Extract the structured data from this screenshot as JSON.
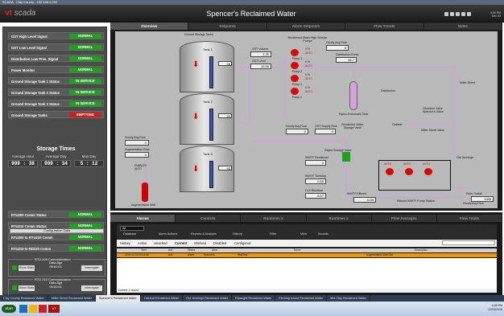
{
  "window": {
    "title": "SCADA - Clay County - 192.168.3.200"
  },
  "header": {
    "logo_prefix": "vt",
    "logo": "scada",
    "title": "Spencer's Reclaimed Water",
    "time": "4:00 PM",
    "date": "Dec 03"
  },
  "signals": [
    {
      "label": "GST High Level Signal",
      "status": "NORMAL",
      "color": "green"
    },
    {
      "label": "GST Low Level Signal",
      "status": "NORMAL",
      "color": "green"
    },
    {
      "label": "Distribution Low Pres. Signal",
      "status": "NORMAL",
      "color": "green"
    },
    {
      "label": "Power Monitor",
      "status": "NORMAL",
      "color": "green"
    },
    {
      "label": "Ground Storage Tank 1 Status",
      "status": "IN SERVICE",
      "color": "green"
    },
    {
      "label": "Ground Storage Tank 2 Status",
      "status": "IN SERVICE",
      "color": "green"
    },
    {
      "label": "Ground Storage Tank 3 Status",
      "status": "IN SERVICE",
      "color": "green"
    },
    {
      "label": "Ground Storage Tanks",
      "status": "EMPTYING",
      "color": "red"
    }
  ],
  "storage": {
    "title": "Storage Times",
    "cols": [
      {
        "h": "Average Hour",
        "v": "999 : 38"
      },
      {
        "h": "Average Day",
        "v": "999 : 34"
      },
      {
        "h": "Max Day",
        "v": "5 : 12"
      }
    ]
  },
  "config": {
    "label": "Configuration Data"
  },
  "rtu": {
    "title1": "RTU 200 Communications",
    "statuses": [
      {
        "label": "RTU200 Comm Status",
        "status": "NORMAL"
      },
      {
        "label": "RTU210 Comm Status",
        "status": "NORMAL"
      },
      {
        "label": "RTU200 to RTU210 Comm",
        "status": "NORMAL"
      },
      {
        "label": "RTU210 to RD220 Comm",
        "status": "NORMAL"
      }
    ]
  },
  "groups": [
    {
      "title": "RTU 200 Communication",
      "show": "Show Stats",
      "data_age_label": "Data Age",
      "data_age": "00:00:01",
      "interrogate": "Interrogate"
    },
    {
      "title": "RTU 210 Communication",
      "show": "Show Stats",
      "data_age_label": "Data Age",
      "data_age": "00:00:01",
      "interrogate": "Interrogate"
    }
  ],
  "main_tabs": [
    {
      "label": "Overview",
      "active": true
    },
    {
      "label": "Setpoints"
    },
    {
      "label": "Alarm Setpoints"
    },
    {
      "label": "Flow Trends"
    },
    {
      "label": "Notes"
    }
  ],
  "diagram": {
    "gst_title": "Ground Storage Tanks",
    "tanks": [
      {
        "label": "Tank 1",
        "value": "93"
      },
      {
        "label": "Tank 2",
        "value": "93"
      },
      {
        "label": "Tank 3",
        "value": "93"
      }
    ],
    "gst_volume": {
      "label": "GST Volume",
      "value": "1.39"
    },
    "gst_level": {
      "label": "GST Level",
      "value": "19.56"
    },
    "pumps_title": "Reclaimed Water High Service Pumps",
    "pumps": [
      {
        "label": "Pump 1",
        "pct": "0 %"
      },
      {
        "label": "Pump 2",
        "pct": "0 %"
      },
      {
        "label": "Pump 3",
        "pct": "0 %"
      },
      {
        "label": "Pump 4",
        "pct": "0 %"
      }
    ],
    "hourly_avg_top": {
      "label": "Hourly Avg Flow",
      "value": "5"
    },
    "dist_press": {
      "label": "Distribution Press.",
      "value": "55.7"
    },
    "hydro": "Hydro-Pneumatic Tank",
    "distribution": "Distribution",
    "miller_street": "Miller Street",
    "diversion": "Diversion Valve Spencer's Valve",
    "miller_valve": "Miller Street Valve",
    "oakleaf": "Oakleaf",
    "old_jennings": "Old Jennings",
    "hourly_avg_left": {
      "label": "Hourly Avg Flow",
      "value": "0"
    },
    "aug_flow": {
      "label": "Augmentation Flow",
      "value": "0"
    },
    "aug_well": "Augmentation Well",
    "aug_tag": "ENABLED AUTO",
    "hourly_avg_mid": {
      "label": "Hourly Avg Flow",
      "value": "0"
    },
    "gst_supply": {
      "label": "GST Supply Flow",
      "value": "0"
    },
    "rw_storage_valve": "Reclaimed Water Storage Valve",
    "reject_valve": "Reject Storage Valve",
    "wwtf_rw": {
      "label": "WWTF Reclaimed",
      "value": "0"
    },
    "wwtf_turb": {
      "label": "WWTF Turbidity",
      "value": "0.55"
    },
    "cl2": {
      "label": "CL2 Residual",
      "value": "8.57"
    },
    "wwtf_effluent": "WWTF Effluent",
    "wwtf_flow": {
      "value": "1139"
    },
    "river_outfall": "River Outfall",
    "hourly_avg_right": {
      "label": "Hourly Avg Flow",
      "value": "1358"
    },
    "effluent_station": "Effluent WWTF Pump Station",
    "auto": "AUTO"
  },
  "bottom_tabs": [
    {
      "label": "Alarms",
      "active": true
    },
    {
      "label": "Controls"
    },
    {
      "label": "Runtimes 1"
    },
    {
      "label": "Runtimes 2"
    },
    {
      "label": "Flow Averages"
    },
    {
      "label": "Flow Totals"
    }
  ],
  "toolbar": [
    {
      "label": "Database"
    },
    {
      "label": "Alarm Actions"
    },
    {
      "label": "Reports & Analysis"
    },
    {
      "label": "History"
    },
    {
      "label": "Filter"
    },
    {
      "label": "View"
    },
    {
      "label": "Sounds"
    }
  ],
  "toolbar_select": "All",
  "filters": [
    "History",
    "Active",
    "Unacked",
    "Current",
    "Shelved",
    "Disabled",
    "Configured"
  ],
  "alarm_cols": [
    "Time",
    "Ack",
    "Status",
    "Area",
    "Name",
    "Description"
  ],
  "alarm_row": {
    "time": "2016-12-03 09:43:08",
    "ack": "Ack",
    "status": "Alarm",
    "area": "Spencers",
    "name": "WaitTest",
    "desc": "Augmentation Well Fail"
  },
  "alarm_footer": "Current: 1 record",
  "taskbar": [
    "Clay County Reclaimed Water",
    "Miller Street Reclaimed Water",
    "Spencer's Reclaimed Water",
    "Oakleaf Reclaimed Water",
    "Old Jennings Reclaimed Water",
    "Ridaught Reclaimed Water",
    "Fleming Island Reclaimed Water",
    "Mid Clay Reclaimed Water"
  ],
  "tray": {
    "time": "4:06 PM",
    "date": "12/03/2016"
  },
  "start": "Start",
  "colors": {
    "normal": "#1ea21e",
    "alarm": "#d21b1b",
    "alarm_row": "#f29400",
    "level": "#1f5bd6"
  }
}
